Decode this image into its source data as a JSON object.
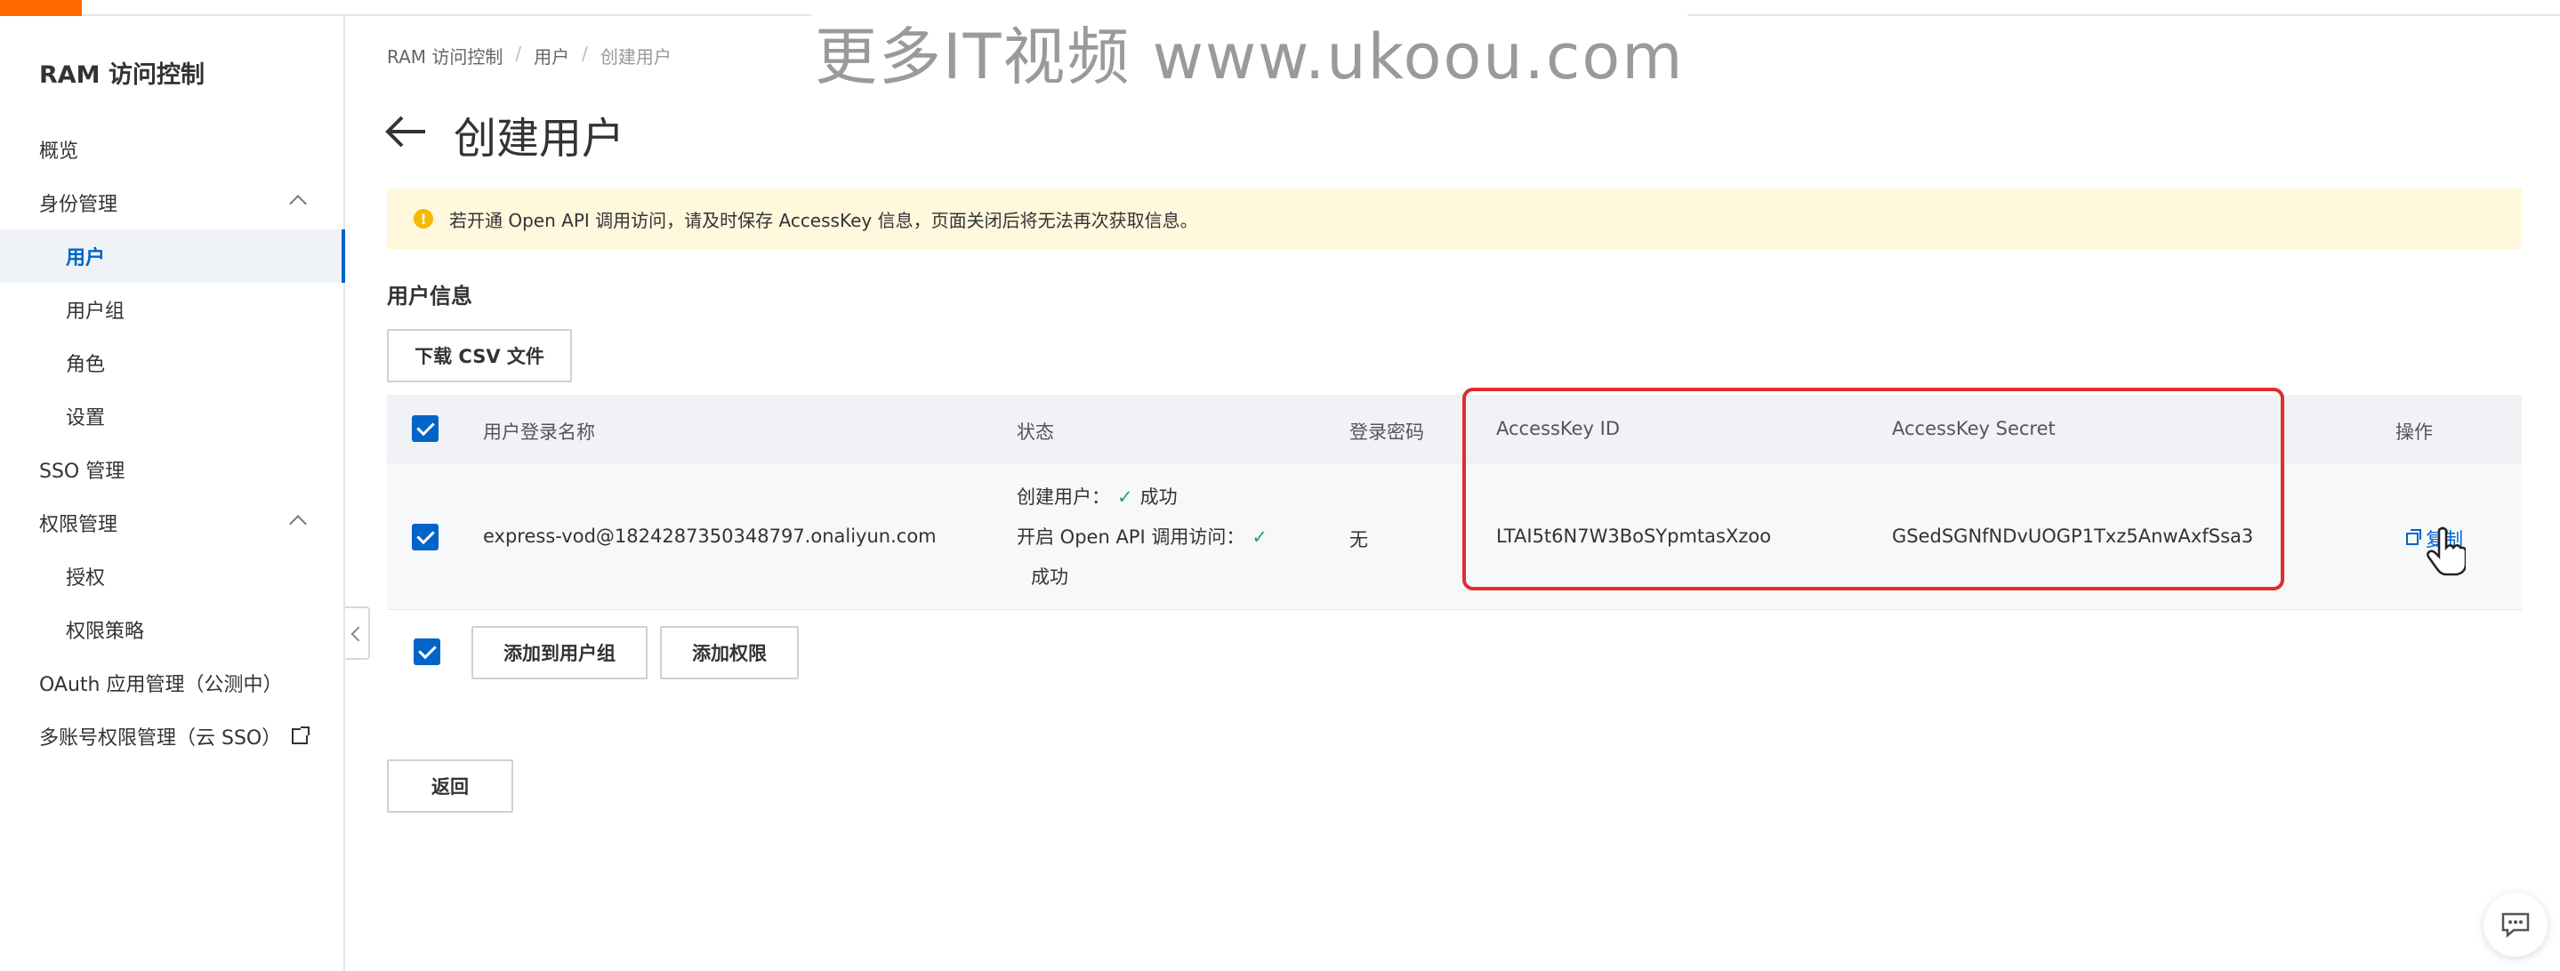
{
  "watermark": "更多IT视频 www.ukoou.com",
  "sidebar": {
    "title": "RAM 访问控制",
    "items": [
      {
        "label": "概览"
      },
      {
        "label": "身份管理"
      },
      {
        "label": "用户"
      },
      {
        "label": "用户组"
      },
      {
        "label": "角色"
      },
      {
        "label": "设置"
      },
      {
        "label": "SSO 管理"
      },
      {
        "label": "权限管理"
      },
      {
        "label": "授权"
      },
      {
        "label": "权限策略"
      },
      {
        "label": "OAuth 应用管理（公测中）"
      },
      {
        "label": "多账号权限管理（云 SSO）"
      }
    ]
  },
  "breadcrumb": [
    "RAM 访问控制",
    "用户",
    "创建用户"
  ],
  "breadcrumb_sep": "/",
  "page_title": "创建用户",
  "alert": {
    "icon": "!",
    "text": "若开通 Open API 调用访问，请及时保存 AccessKey 信息，页面关闭后将无法再次获取信息。",
    "color": "#fff8dc"
  },
  "section_title": "用户信息",
  "download_csv_label": "下载 CSV 文件",
  "table": {
    "columns": [
      "用户登录名称",
      "状态",
      "登录密码",
      "AccessKey ID",
      "AccessKey Secret",
      "操作"
    ],
    "rows": [
      {
        "login_name": "express-vod@1824287350348797.onaliyun.com",
        "status_create_label": "创建用户：",
        "status_create_value": "成功",
        "status_api_label": "开启 Open API 调用访问：",
        "status_api_value": "成功",
        "check_mark": "✓",
        "password": "无",
        "access_key_id": "LTAI5t6N7W3BoSYpmtasXzoo",
        "access_key_secret": "GSedSGNfNDvUOGP1Txz5AnwAxfSsa3",
        "action": "复制"
      }
    ]
  },
  "footer_buttons": {
    "add_to_group": "添加到用户组",
    "add_permission": "添加权限"
  },
  "back_button": "返回",
  "colors": {
    "accent": "#ff6a00",
    "primary": "#0064c8",
    "success": "#23a36d",
    "highlight": "#e02d2d"
  }
}
